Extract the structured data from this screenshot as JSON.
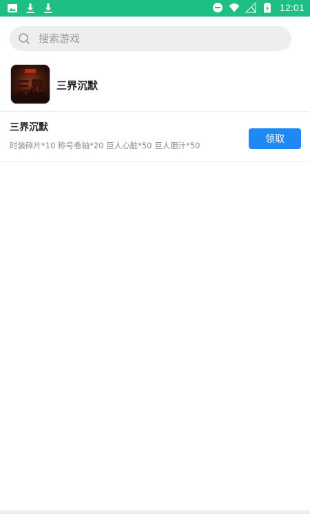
{
  "status_bar": {
    "time": "12:01",
    "left_icons": [
      "image-icon",
      "download-icon",
      "download-icon"
    ],
    "right_icons": [
      "do-not-disturb-icon",
      "wifi-icon",
      "signal-icon",
      "battery-icon"
    ],
    "color": "#1dbf84"
  },
  "search": {
    "placeholder": "搜索游戏",
    "value": ""
  },
  "game": {
    "name": "三界沉默",
    "icon_text": "三界"
  },
  "gifts": [
    {
      "title": "三界沉默",
      "description": "时装碎片*10 称号卷轴*20 巨人心脏*50 巨人胆汁*50",
      "button_label": "领取"
    }
  ],
  "colors": {
    "accent": "#1e88f5",
    "status_bar": "#1dbf84"
  }
}
